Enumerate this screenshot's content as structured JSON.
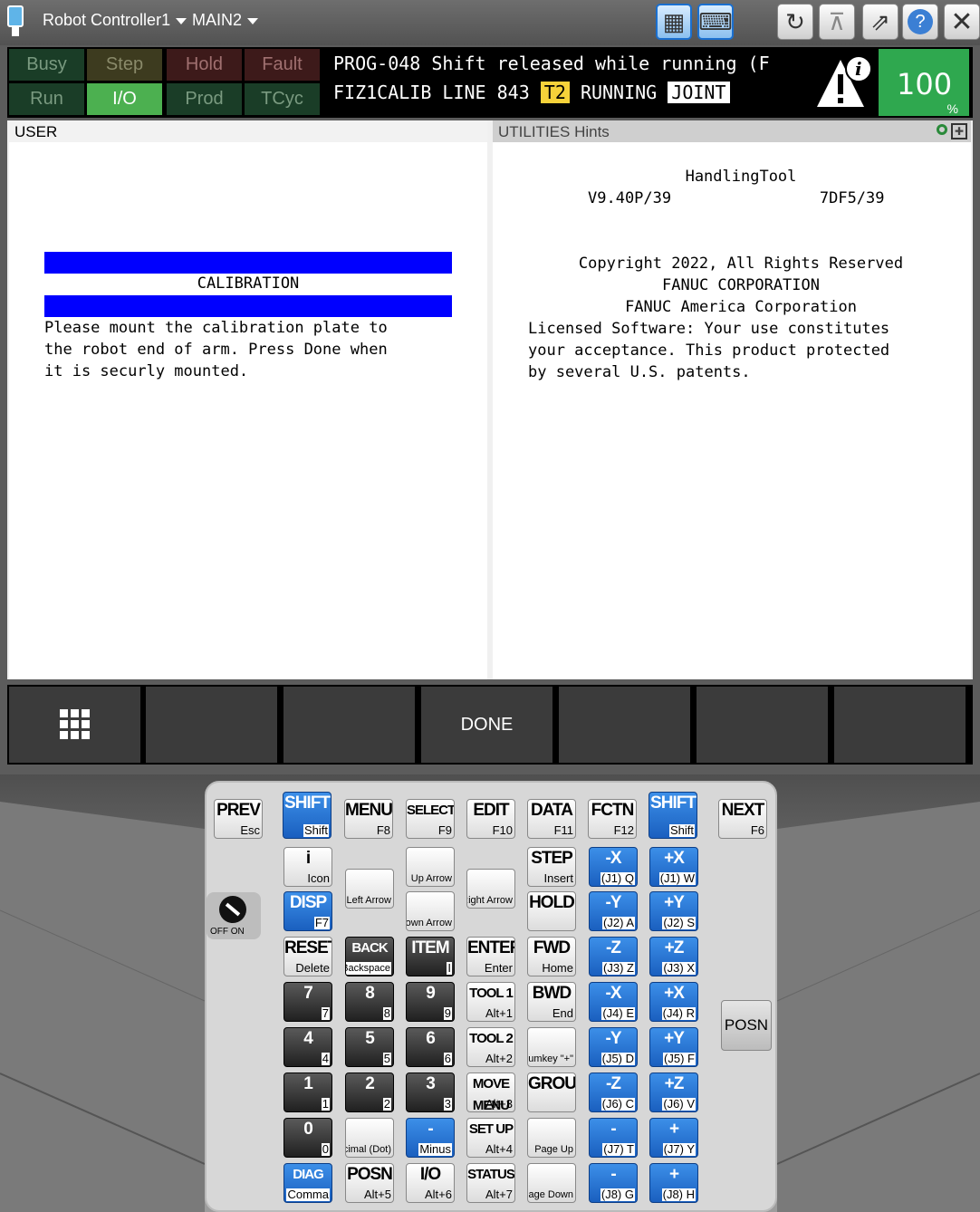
{
  "titlebar": {
    "controller": "Robot Controller1",
    "program": "MAIN2"
  },
  "status": {
    "row1": [
      "Busy",
      "Step",
      "Hold",
      "Fault"
    ],
    "row2": [
      "Run",
      "I/O",
      "Prod",
      "TCyc"
    ]
  },
  "alarm": {
    "line1": "PROG-048 Shift released while running (F",
    "prog": "FIZ1CALIB LINE 843",
    "mode": "T2",
    "state": "RUNNING",
    "coord": "JOINT"
  },
  "override": {
    "value": "100",
    "unit": "%"
  },
  "user_panel": {
    "header": "USER",
    "title": "CALIBRATION",
    "lines": [
      "Please mount the calibration plate to",
      "the robot end of arm. Press Done when",
      "it is securly mounted."
    ]
  },
  "util_panel": {
    "header": "UTILITIES Hints",
    "lines": [
      "HandlingTool",
      "V9.40P/39                7DF5/39",
      "",
      "",
      "Copyright 2022, All Rights Reserved",
      "FANUC CORPORATION",
      "FANUC America Corporation",
      "Licensed Software: Your use constitutes",
      "your acceptance. This product protected",
      "by several U.S. patents."
    ]
  },
  "fkeys": {
    "f3": "DONE"
  },
  "switch": {
    "label": "OFF ON"
  },
  "posn_side": "POSN",
  "keys": [
    {
      "m": "PREV",
      "s": "Esc"
    },
    {
      "m": "SHIFT",
      "s": "Shift"
    },
    {
      "m": "MENU",
      "s": "F8"
    },
    {
      "m": "SELECT",
      "s": "F9"
    },
    {
      "m": "EDIT",
      "s": "F10"
    },
    {
      "m": "DATA",
      "s": "F11"
    },
    {
      "m": "FCTN",
      "s": "F12"
    },
    {
      "m": "SHIFT",
      "s": "Shift"
    },
    {
      "m": "NEXT",
      "s": "F6"
    },
    {
      "m": "i",
      "s": "Icon"
    },
    {
      "m": "DISP",
      "s": "F7"
    },
    {
      "m": "",
      "s": "Left Arrow"
    },
    {
      "m": "",
      "s": "Up Arrow"
    },
    {
      "m": "",
      "s": "Down Arrow"
    },
    {
      "m": "",
      "s": "Right Arrow"
    },
    {
      "m": "STEP",
      "s": "Insert"
    },
    {
      "m": "HOLD",
      "s": ""
    },
    {
      "m": "RESET",
      "s": "Delete"
    },
    {
      "m": "BACK SPACE",
      "s": "Backspace"
    },
    {
      "m": "ITEM",
      "s": "I"
    },
    {
      "m": "ENTER",
      "s": "Enter"
    },
    {
      "m": "FWD",
      "s": "Home"
    },
    {
      "m": "7",
      "s": "7"
    },
    {
      "m": "8",
      "s": "8"
    },
    {
      "m": "9",
      "s": "9"
    },
    {
      "m": "TOOL 1",
      "s": "Alt+1"
    },
    {
      "m": "BWD",
      "s": "End"
    },
    {
      "m": "4",
      "s": "4"
    },
    {
      "m": "5",
      "s": "5"
    },
    {
      "m": "6",
      "s": "6"
    },
    {
      "m": "TOOL 2",
      "s": "Alt+2"
    },
    {
      "m": "",
      "s": "Numkey \"+\""
    },
    {
      "m": "1",
      "s": "1"
    },
    {
      "m": "2",
      "s": "2"
    },
    {
      "m": "3",
      "s": "3"
    },
    {
      "m": "MOVE MENU",
      "s": "Alt+3"
    },
    {
      "m": "GROUP",
      "s": ""
    },
    {
      "m": "0",
      "s": "0"
    },
    {
      "m": "",
      "s": "Decimal (Dot)"
    },
    {
      "m": "-",
      "s": "Minus"
    },
    {
      "m": "SET UP",
      "s": "Alt+4"
    },
    {
      "m": "",
      "s": "Page Up"
    },
    {
      "m": "DIAG HELP",
      "s": "Comma"
    },
    {
      "m": "POSN",
      "s": "Alt+5"
    },
    {
      "m": "I/O",
      "s": "Alt+6"
    },
    {
      "m": "STATUS",
      "s": "Alt+7"
    },
    {
      "m": "",
      "s": "Page Down"
    },
    {
      "m": "-X",
      "s": "(J1) Q"
    },
    {
      "m": "+X",
      "s": "(J1) W"
    },
    {
      "m": "-Y",
      "s": "(J2) A"
    },
    {
      "m": "+Y",
      "s": "(J2) S"
    },
    {
      "m": "-Z",
      "s": "(J3) Z"
    },
    {
      "m": "+Z",
      "s": "(J3) X"
    },
    {
      "m": "-X",
      "s": "(J4) E"
    },
    {
      "m": "+X",
      "s": "(J4) R"
    },
    {
      "m": "-Y",
      "s": "(J5) D"
    },
    {
      "m": "+Y",
      "s": "(J5) F"
    },
    {
      "m": "-Z",
      "s": "(J6) C"
    },
    {
      "m": "+Z",
      "s": "(J6) V"
    },
    {
      "m": "-",
      "s": "(J7) T"
    },
    {
      "m": "+",
      "s": "(J7) Y"
    },
    {
      "m": "-",
      "s": "(J8) G"
    },
    {
      "m": "+",
      "s": "(J8) H"
    }
  ]
}
